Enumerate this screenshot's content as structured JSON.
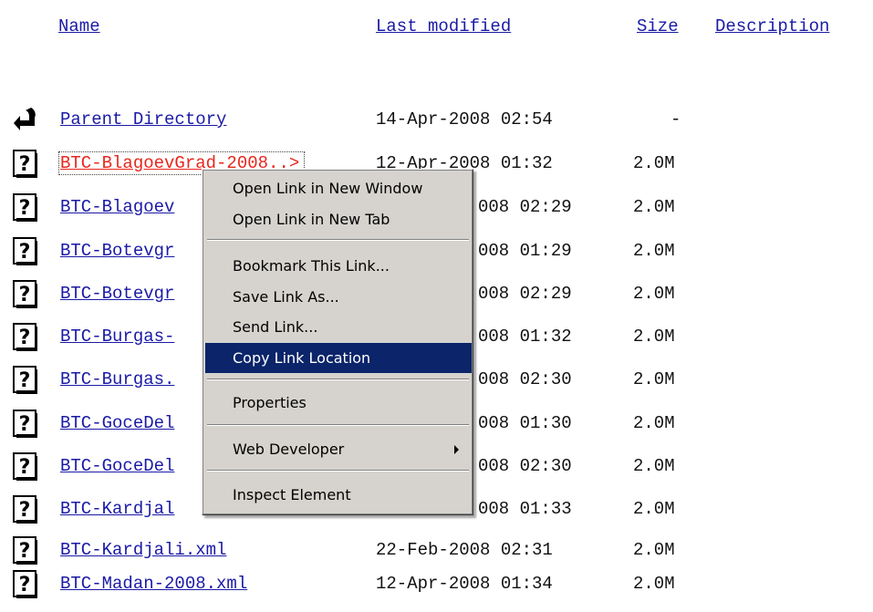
{
  "headers": {
    "name": "Name",
    "last_modified": "Last modified",
    "size": "Size",
    "description": "Description"
  },
  "rows": [
    {
      "icon": "back-arrow-icon",
      "name": "Parent Directory",
      "date": "14-Apr-2008 02:54",
      "size": "-"
    },
    {
      "icon": "unknown-file-icon",
      "name": "BTC-BlagoevGrad-2008..>",
      "date": "12-Apr-2008 01:32",
      "size": "2.0M"
    },
    {
      "icon": "unknown-file-icon",
      "name": "BTC-Blagoev",
      "date": "008 02:29",
      "size": "2.0M"
    },
    {
      "icon": "unknown-file-icon",
      "name": "BTC-Botevgr",
      "date": "008 01:29",
      "size": "2.0M"
    },
    {
      "icon": "unknown-file-icon",
      "name": "BTC-Botevgr",
      "date": "008 02:29",
      "size": "2.0M"
    },
    {
      "icon": "unknown-file-icon",
      "name": "BTC-Burgas-",
      "date": "008 01:32",
      "size": "2.0M"
    },
    {
      "icon": "unknown-file-icon",
      "name": "BTC-Burgas.",
      "date": "008 02:30",
      "size": "2.0M"
    },
    {
      "icon": "unknown-file-icon",
      "name": "BTC-GoceDel",
      "date": "008 01:30",
      "size": "2.0M"
    },
    {
      "icon": "unknown-file-icon",
      "name": "BTC-GoceDel",
      "date": "008 02:30",
      "size": "2.0M"
    },
    {
      "icon": "unknown-file-icon",
      "name": "BTC-Kardjal",
      "date": "008 01:33",
      "size": "2.0M"
    },
    {
      "icon": "unknown-file-icon",
      "name": "BTC-Kardjali.xml",
      "date": "22-Feb-2008 02:31",
      "size": "2.0M"
    },
    {
      "icon": "unknown-file-icon",
      "name": "BTC-Madan-2008.xml",
      "date": "12-Apr-2008 01:34",
      "size": "2.0M"
    }
  ],
  "context_menu": {
    "items": [
      {
        "label": "Open Link in New Window"
      },
      {
        "label": "Open Link in New Tab"
      },
      {
        "label": "Bookmark This Link..."
      },
      {
        "label": "Save Link As..."
      },
      {
        "label": "Send Link..."
      },
      {
        "label": "Copy Link Location",
        "highlighted": true
      },
      {
        "label": "Properties"
      },
      {
        "label": "Web Developer",
        "submenu": true
      },
      {
        "label": "Inspect Element"
      }
    ]
  },
  "colors": {
    "link": "#1a1aa6",
    "active_link": "#e8261d",
    "menu_bg": "#d6d3ce",
    "menu_highlight": "#0b246a"
  }
}
